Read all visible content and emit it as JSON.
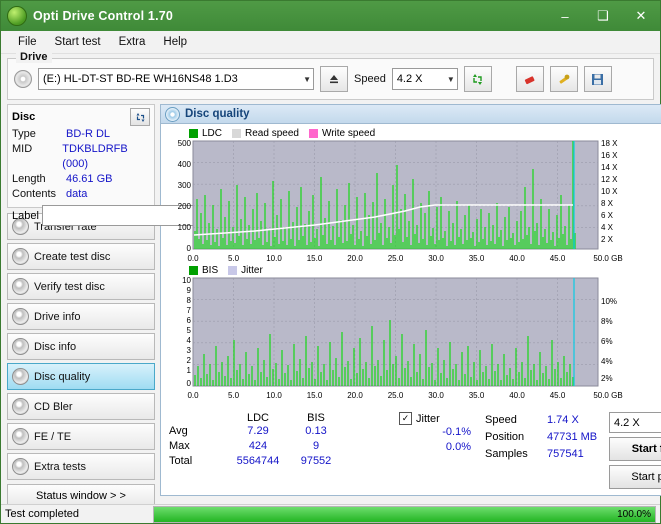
{
  "window": {
    "title": "Opti Drive Control 1.70",
    "app_icon": "disc-icon",
    "minimize": "–",
    "maximize": "❑",
    "close": "✕"
  },
  "menu": [
    {
      "label": "File"
    },
    {
      "label": "Start test"
    },
    {
      "label": "Extra"
    },
    {
      "label": "Help"
    }
  ],
  "drive": {
    "legend": "Drive",
    "selected": "(E:)  HL-DT-ST BD-RE  WH16NS48 1.D3",
    "eject_icon": "eject-icon",
    "speed_label": "Speed",
    "speed_value": "4.2 X",
    "buttons": {
      "refresh_icon": "refresh-arrows-icon",
      "erase_icon": "eraser-icon",
      "tools_icon": "tools-icon",
      "save_icon": "floppy-save-icon"
    }
  },
  "disc": {
    "legend": "Disc",
    "refresh_icon": "refresh-icon",
    "rows": [
      {
        "key": "Type",
        "value": "BD-R DL"
      },
      {
        "key": "MID",
        "value": "TDKBLDRFB (000)"
      },
      {
        "key": "Length",
        "value": "46.61 GB"
      },
      {
        "key": "Contents",
        "value": "data"
      }
    ],
    "label_key": "Label",
    "label_value": "",
    "globe_icon": "globe-icon"
  },
  "nav": {
    "items": [
      {
        "label": "Transfer rate",
        "active": false
      },
      {
        "label": "Create test disc",
        "active": false
      },
      {
        "label": "Verify test disc",
        "active": false
      },
      {
        "label": "Drive info",
        "active": false
      },
      {
        "label": "Disc info",
        "active": false
      },
      {
        "label": "Disc quality",
        "active": true
      },
      {
        "label": "CD Bler",
        "active": false
      },
      {
        "label": "FE / TE",
        "active": false
      },
      {
        "label": "Extra tests",
        "active": false
      }
    ],
    "status_window": "Status window > >"
  },
  "quality": {
    "title": "Disc quality",
    "title_icon": "disc-quality-icon"
  },
  "chart_data": [
    {
      "type": "line",
      "title": "LDC / Read speed / Write speed",
      "legend": [
        {
          "label": "LDC",
          "color": "#00a000"
        },
        {
          "label": "Read speed",
          "color": "#d8d8d8"
        },
        {
          "label": "Write speed",
          "color": "#ff66cc"
        }
      ],
      "xlabel": "GB",
      "x_ticks": [
        "0.0",
        "5.0",
        "10.0",
        "15.0",
        "20.0",
        "25.0",
        "30.0",
        "35.0",
        "40.0",
        "45.0",
        "50.0 GB"
      ],
      "xlim": [
        0,
        50
      ],
      "ylabel_left": "LDC",
      "y_ticks_left": [
        "100",
        "200",
        "300",
        "400",
        "500"
      ],
      "ylim_left": [
        0,
        500
      ],
      "ylabel_right": "Speed",
      "y_ticks_right": [
        "2 X",
        "4 X",
        "6 X",
        "8 X",
        "10 X",
        "12 X",
        "14 X",
        "16 X",
        "18 X"
      ],
      "ylim_right": [
        0,
        18
      ],
      "grid": true,
      "series": [
        {
          "name": "LDC",
          "color": "#00d000",
          "avg": 7.29,
          "max": 424,
          "total": 5564744
        },
        {
          "name": "Read speed",
          "color": "#ffffff",
          "values_note": "rises 2X to ~6X across disc"
        }
      ]
    },
    {
      "type": "bar",
      "title": "BIS / Jitter",
      "legend": [
        {
          "label": "BIS",
          "color": "#00a000"
        },
        {
          "label": "Jitter",
          "color": "#c8c8e8"
        }
      ],
      "xlabel": "GB",
      "x_ticks": [
        "0.0",
        "5.0",
        "10.0",
        "15.0",
        "20.0",
        "25.0",
        "30.0",
        "35.0",
        "40.0",
        "45.0",
        "50.0 GB"
      ],
      "xlim": [
        0,
        50
      ],
      "ylabel_left": "BIS",
      "y_ticks_left": [
        "1",
        "2",
        "3",
        "4",
        "5",
        "6",
        "7",
        "8",
        "9",
        "10"
      ],
      "ylim_left": [
        0,
        10
      ],
      "ylabel_right": "Jitter",
      "y_ticks_right": [
        "2%",
        "4%",
        "6%",
        "8%",
        "10%"
      ],
      "ylim_right": [
        0,
        10
      ],
      "grid": true,
      "series": [
        {
          "name": "BIS",
          "color": "#00d000",
          "avg": 0.13,
          "max": 9,
          "total": 97552
        }
      ]
    }
  ],
  "stats": {
    "col_ldc": "LDC",
    "col_bis": "BIS",
    "jitter_label": "Jitter",
    "jitter_checked": true,
    "rows": [
      {
        "label": "Avg",
        "ldc": "7.29",
        "bis": "0.13",
        "jitter": "-0.1%"
      },
      {
        "label": "Max",
        "ldc": "424",
        "bis": "9",
        "jitter": "0.0%"
      },
      {
        "label": "Total",
        "ldc": "5564744",
        "bis": "97552",
        "jitter": ""
      }
    ],
    "speed_label": "Speed",
    "speed_value": "1.74 X",
    "speed_select": "4.2 X",
    "position_label": "Position",
    "position_value": "47731 MB",
    "samples_label": "Samples",
    "samples_value": "757541",
    "start_full": "Start full",
    "start_part": "Start part"
  },
  "statusbar": {
    "text": "Test completed",
    "percent_label": "100.0%",
    "percent_value": 100
  }
}
